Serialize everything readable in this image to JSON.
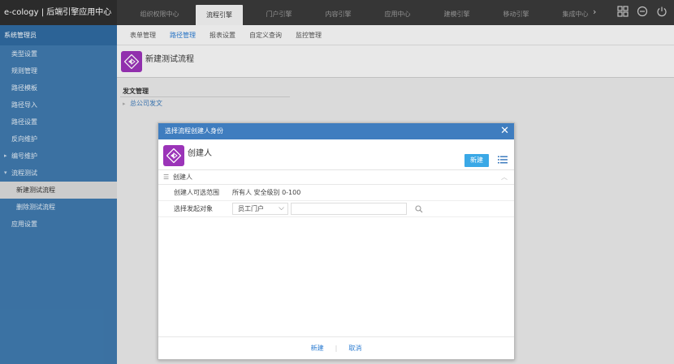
{
  "app": {
    "title": "e-cology | 后端引擎应用中心"
  },
  "top_tabs": [
    {
      "label": "组织权限中心"
    },
    {
      "label": "流程引擎",
      "active": true
    },
    {
      "label": "门户引擎"
    },
    {
      "label": "内容引擎"
    },
    {
      "label": "应用中心"
    },
    {
      "label": "建模引擎"
    },
    {
      "label": "移动引擎"
    },
    {
      "label": "集成中心"
    },
    {
      "label": "运维中心"
    }
  ],
  "top_icons": [
    "grid-icon",
    "minus-circle-icon",
    "power-icon"
  ],
  "sidebar": {
    "header": "系统管理员",
    "items": [
      {
        "label": "类型设置"
      },
      {
        "label": "规则管理"
      },
      {
        "label": "路径模板"
      },
      {
        "label": "路径导入"
      },
      {
        "label": "路径设置"
      },
      {
        "label": "反向维护"
      },
      {
        "label": "编号维护"
      },
      {
        "label": "流程测试"
      },
      {
        "label": "新建测试流程"
      },
      {
        "label": "删除测试流程"
      },
      {
        "label": "应用设置"
      }
    ]
  },
  "sub_tabs": [
    {
      "label": "表单管理"
    },
    {
      "label": "路径管理",
      "active": true
    },
    {
      "label": "报表设置"
    },
    {
      "label": "自定义查询"
    },
    {
      "label": "监控管理"
    }
  ],
  "page": {
    "title": "新建测试流程",
    "section_title": "发文管理",
    "section_item": "总公司发文"
  },
  "modal": {
    "title": "选择流程创建人身份",
    "header_title": "创建人",
    "new_button": "新建",
    "section_label": "创建人",
    "range_label": "创建人可选范围",
    "range_value": "所有人  安全级别  0-100",
    "target_label": "选择发起对象",
    "select_value": "员工门户",
    "search_value": "",
    "footer_new": "新建",
    "footer_sep": "|",
    "footer_cancel": "取消"
  },
  "colors": {
    "topbar": "#3a3a3a",
    "sidebar": "#3f79ad",
    "accent": "#3f7dbf",
    "logo": "#9b34b8",
    "button": "#3aa8e6"
  }
}
